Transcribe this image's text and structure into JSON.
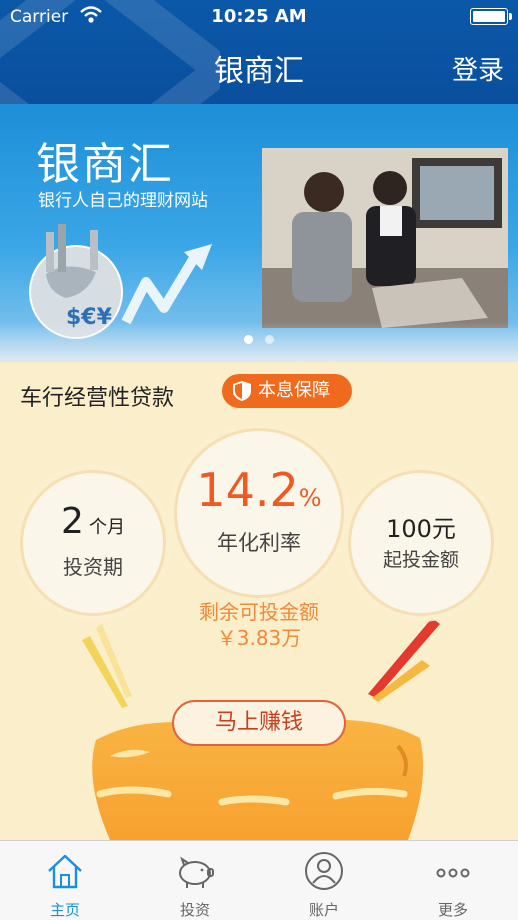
{
  "status_bar": {
    "carrier": "Carrier",
    "time": "10:25 AM"
  },
  "nav": {
    "title": "银商汇",
    "login_label": "登录"
  },
  "banner": {
    "brand": "银商汇",
    "slogan": "银行人自己的理财网站",
    "slide_count": 2,
    "active_slide": 1
  },
  "product": {
    "title": "车行经营性贷款",
    "badge": "本息保障",
    "period_value": "2",
    "period_unit": "个月",
    "period_label": "投资期",
    "rate_value": "14.2",
    "rate_unit": "%",
    "rate_label": "年化利率",
    "min_invest_value": "100元",
    "min_invest_label": "起投金额",
    "remaining_label": "剩余可投金额",
    "remaining_value": "￥3.83万",
    "cta_label": "马上赚钱"
  },
  "tabbar": {
    "tabs": [
      {
        "label": "主页",
        "icon": "home-icon",
        "active": true
      },
      {
        "label": "投资",
        "icon": "piggy-bank-icon",
        "active": false
      },
      {
        "label": "账户",
        "icon": "user-icon",
        "active": false
      },
      {
        "label": "更多",
        "icon": "more-icon",
        "active": false
      }
    ]
  },
  "colors": {
    "nav_blue": "#0a4f9e",
    "accent_orange": "#f06a1e",
    "rate_orange": "#ee5a24",
    "active_tab": "#1a8fe0",
    "background": "#fbeecb"
  }
}
